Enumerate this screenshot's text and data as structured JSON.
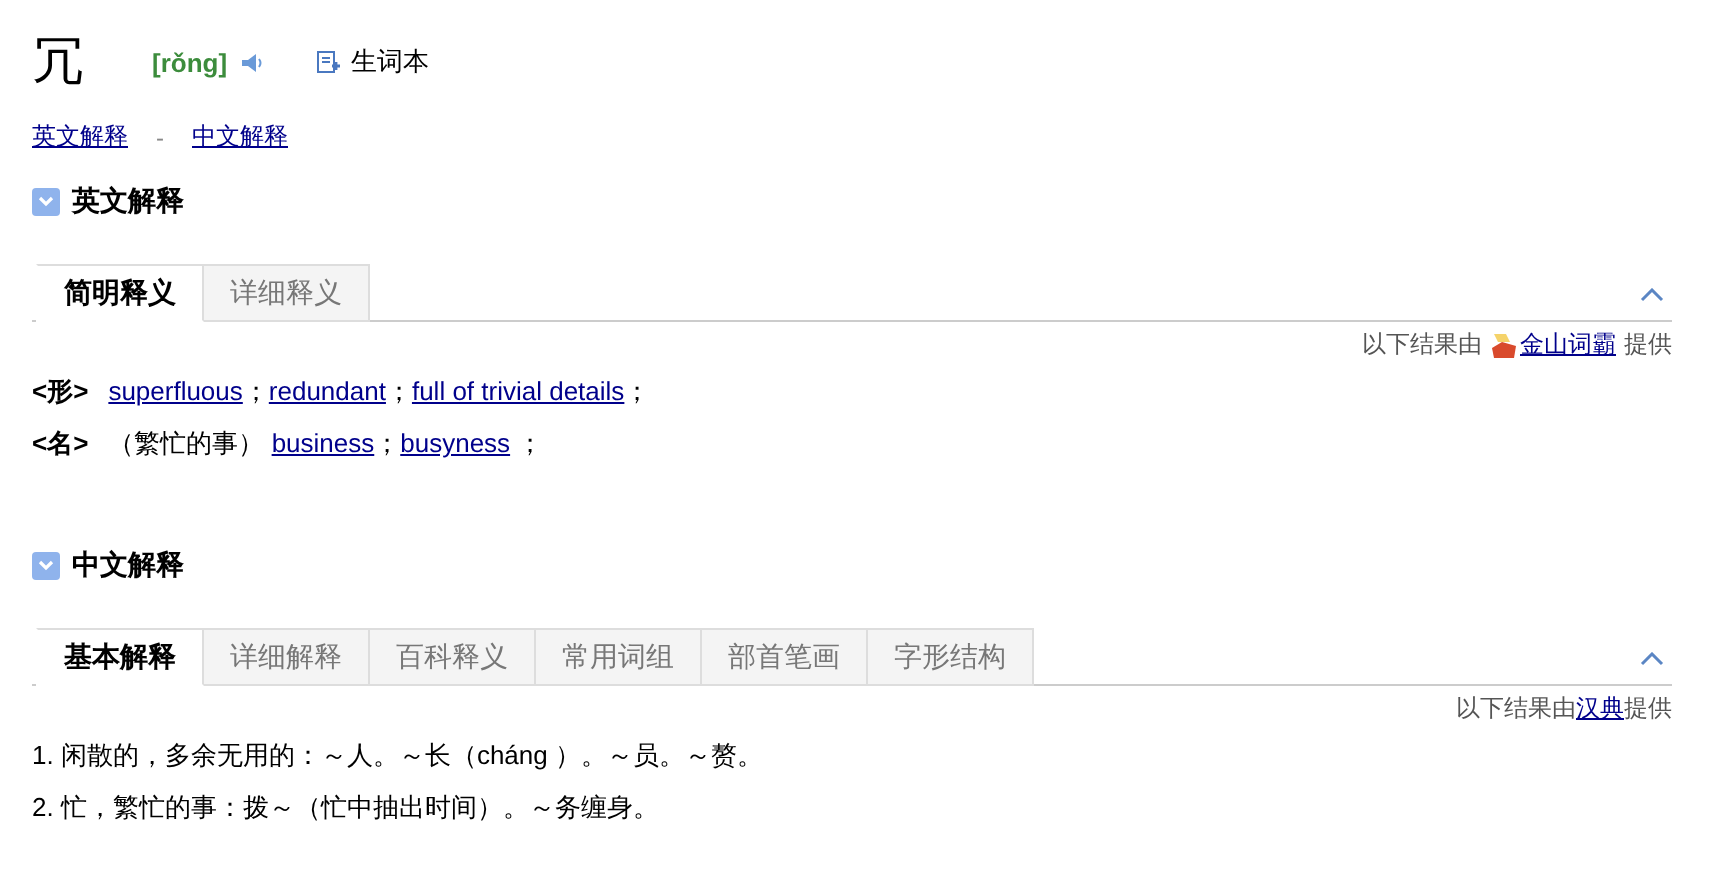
{
  "headword": {
    "character": "冗",
    "pinyin": "[rǒng]",
    "wordbook": "生词本"
  },
  "anchors": [
    {
      "text": "英文解释"
    },
    {
      "text": "中文解释"
    }
  ],
  "anchor_separator": "-",
  "sections": [
    {
      "title": "英文解释",
      "expanded": true,
      "tabs": [
        {
          "label": "简明释义",
          "selected": true
        },
        {
          "label": "详细释义",
          "selected": false
        }
      ],
      "credit": {
        "before": "以下结果由",
        "source": "金山词霸",
        "after": "提供",
        "logo": true
      },
      "lines": [
        {
          "kind": "pos",
          "pos": "<形>",
          "segments": [
            {
              "kind": "link",
              "text": "superfluous"
            },
            {
              "kind": "text",
              "text": "；"
            },
            {
              "kind": "link",
              "text": "redundant"
            },
            {
              "kind": "text",
              "text": "；"
            },
            {
              "kind": "link",
              "text": "full of trivial details"
            },
            {
              "kind": "text",
              "text": "；"
            }
          ]
        },
        {
          "kind": "pos",
          "pos": "<名>",
          "segments": [
            {
              "kind": "text",
              "text": "（繁忙的事） "
            },
            {
              "kind": "link",
              "text": "business"
            },
            {
              "kind": "text",
              "text": "；"
            },
            {
              "kind": "link",
              "text": "busyness"
            },
            {
              "kind": "text",
              "text": " ；"
            }
          ]
        }
      ]
    },
    {
      "title": "中文解释",
      "expanded": true,
      "tabs": [
        {
          "label": "基本解释",
          "selected": true
        },
        {
          "label": "详细解释",
          "selected": false
        },
        {
          "label": "百科释义",
          "selected": false
        },
        {
          "label": "常用词组",
          "selected": false
        },
        {
          "label": "部首笔画",
          "selected": false
        },
        {
          "label": "字形结构",
          "selected": false
        }
      ],
      "credit": {
        "before": "以下结果由",
        "source": "汉典",
        "after": "提供",
        "logo": false
      },
      "lines": [
        {
          "kind": "plain",
          "text": "1. 闲散的，多余无用的：～人。～长（cháng ）。～员。～赘。"
        },
        {
          "kind": "plain",
          "text": "2. 忙，繁忙的事：拨～（忙中抽出时间）。～务缠身。"
        }
      ]
    }
  ]
}
